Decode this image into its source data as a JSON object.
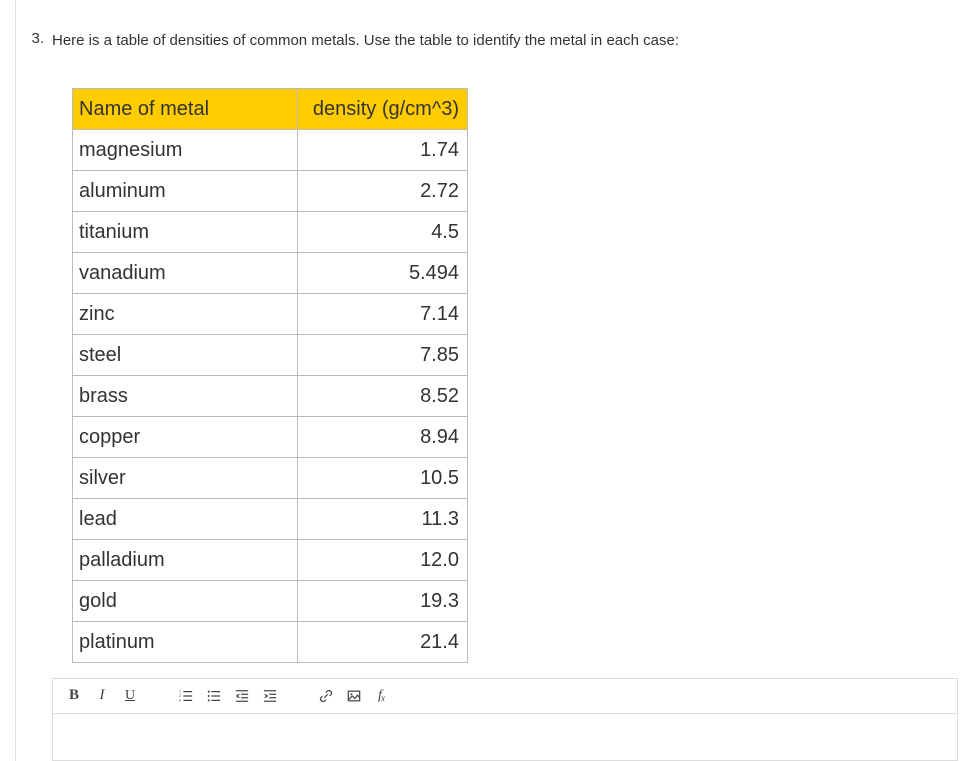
{
  "question": {
    "number": "3.",
    "text": "Here is a table of densities of common metals. Use the table to identify the metal in each case:"
  },
  "table": {
    "headers": {
      "name": "Name of metal",
      "density": "density (g/cm^3)"
    },
    "rows": [
      {
        "name": "magnesium",
        "density": "1.74"
      },
      {
        "name": "aluminum",
        "density": "2.72"
      },
      {
        "name": "titanium",
        "density": "4.5"
      },
      {
        "name": "vanadium",
        "density": "5.494"
      },
      {
        "name": "zinc",
        "density": "7.14"
      },
      {
        "name": "steel",
        "density": "7.85"
      },
      {
        "name": "brass",
        "density": "8.52"
      },
      {
        "name": "copper",
        "density": "8.94"
      },
      {
        "name": "silver",
        "density": "10.5"
      },
      {
        "name": "lead",
        "density": "11.3"
      },
      {
        "name": "palladium",
        "density": "12.0"
      },
      {
        "name": "gold",
        "density": "19.3"
      },
      {
        "name": "platinum",
        "density": "21.4"
      }
    ]
  },
  "toolbar": {
    "bold": "B",
    "italic": "I",
    "underline": "U",
    "fx_f": "f",
    "fx_x": "x"
  },
  "chart_data": {
    "type": "table",
    "title": "Densities of common metals",
    "columns": [
      "Name of metal",
      "density (g/cm^3)"
    ],
    "rows": [
      [
        "magnesium",
        1.74
      ],
      [
        "aluminum",
        2.72
      ],
      [
        "titanium",
        4.5
      ],
      [
        "vanadium",
        5.494
      ],
      [
        "zinc",
        7.14
      ],
      [
        "steel",
        7.85
      ],
      [
        "brass",
        8.52
      ],
      [
        "copper",
        8.94
      ],
      [
        "silver",
        10.5
      ],
      [
        "lead",
        11.3
      ],
      [
        "palladium",
        12.0
      ],
      [
        "gold",
        19.3
      ],
      [
        "platinum",
        21.4
      ]
    ]
  }
}
